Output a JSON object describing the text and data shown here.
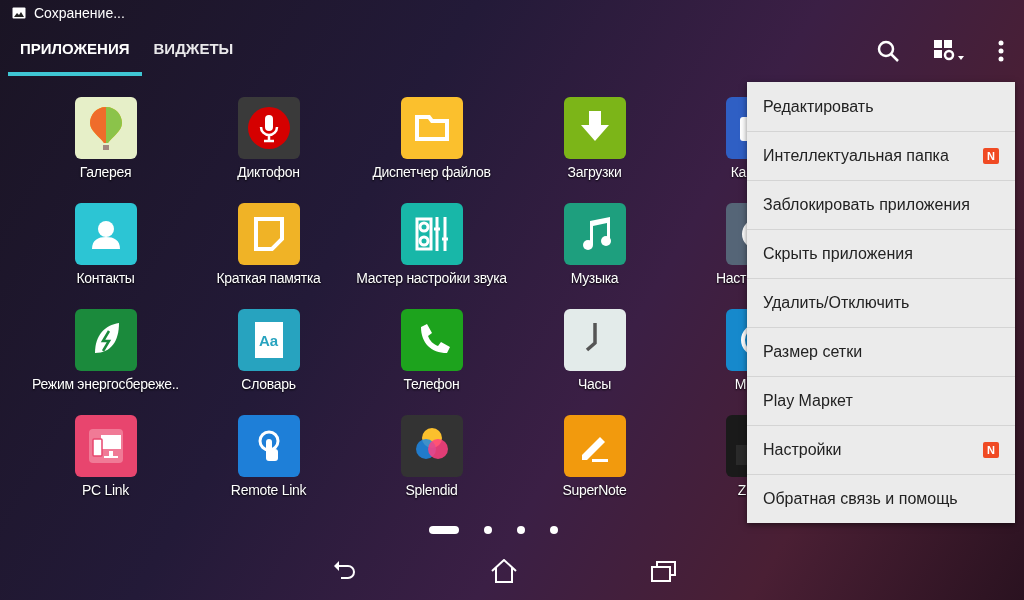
{
  "status_bar": {
    "text": "Сохранение..."
  },
  "tabs": [
    {
      "label": "ПРИЛОЖЕНИЯ",
      "selected": true
    },
    {
      "label": "ВИДЖЕТЫ",
      "selected": false
    }
  ],
  "apps": [
    {
      "label": "Галерея"
    },
    {
      "label": "Диктофон"
    },
    {
      "label": "Диспетчер файлов"
    },
    {
      "label": "Загрузки"
    },
    {
      "label": "Ка"
    },
    {
      "label": "Контакты"
    },
    {
      "label": "Краткая памятка"
    },
    {
      "label": "Мастер настройки звука"
    },
    {
      "label": "Музыка"
    },
    {
      "label": "Наст"
    },
    {
      "label": "Режим энергосбереже.."
    },
    {
      "label": "Словарь",
      "icon_text": "Aa"
    },
    {
      "label": "Телефон"
    },
    {
      "label": "Часы"
    },
    {
      "label": "М"
    },
    {
      "label": "PC Link"
    },
    {
      "label": "Remote Link"
    },
    {
      "label": "Splendid"
    },
    {
      "label": "SuperNote"
    },
    {
      "label": "Z"
    }
  ],
  "menu": [
    {
      "label": "Редактировать"
    },
    {
      "label": "Интеллектуальная папка",
      "badge": "N"
    },
    {
      "label": "Заблокировать приложения"
    },
    {
      "label": "Скрыть приложения"
    },
    {
      "label": "Удалить/Отключить"
    },
    {
      "label": "Размер сетки"
    },
    {
      "label": "Play Маркет"
    },
    {
      "label": "Настройки",
      "badge": "N"
    },
    {
      "label": "Обратная связь и помощь"
    }
  ],
  "pages": [
    {
      "selected": true
    },
    {
      "selected": false
    },
    {
      "selected": false
    },
    {
      "selected": false
    }
  ]
}
